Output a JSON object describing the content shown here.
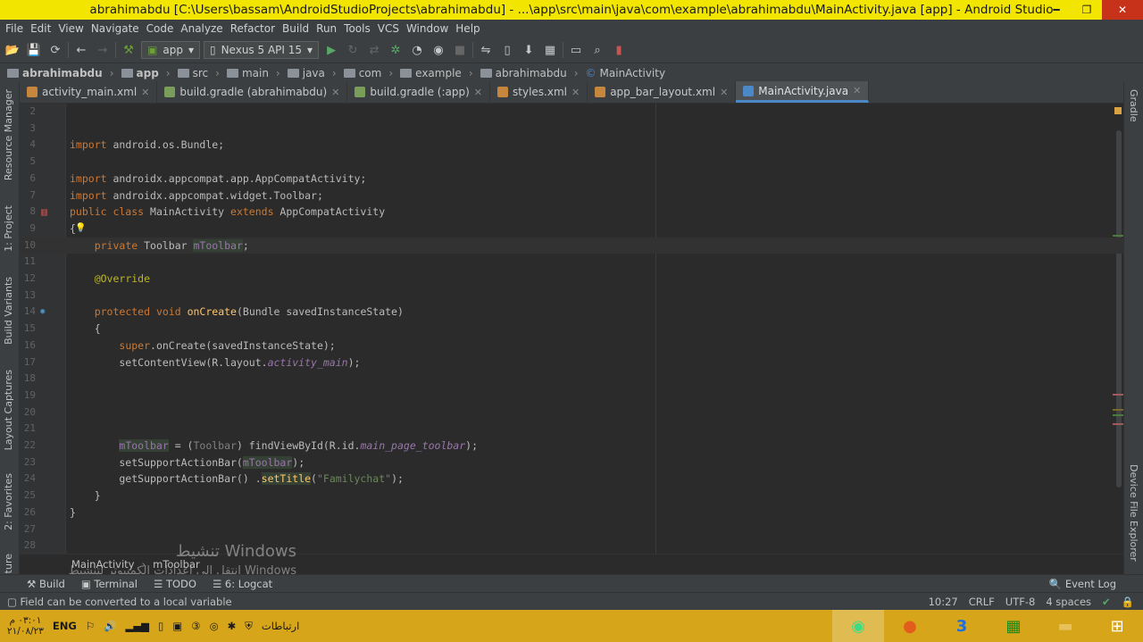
{
  "window": {
    "title": "abrahimabdu [C:\\Users\\bassam\\AndroidStudioProjects\\abrahimabdu] - ...\\app\\src\\main\\java\\com\\example\\abrahimabdu\\MainActivity.java [app] - Android Studio"
  },
  "menu": [
    "File",
    "Edit",
    "View",
    "Navigate",
    "Code",
    "Analyze",
    "Refactor",
    "Build",
    "Run",
    "Tools",
    "VCS",
    "Window",
    "Help"
  ],
  "toolbar": {
    "run_config": "app",
    "device": "Nexus 5 API 15"
  },
  "breadcrumb": [
    "abrahimabdu",
    "app",
    "src",
    "main",
    "java",
    "com",
    "example",
    "abrahimabdu",
    "MainActivity"
  ],
  "tabs": [
    {
      "label": "activity_main.xml",
      "active": false
    },
    {
      "label": "build.gradle (abrahimabdu)",
      "active": false
    },
    {
      "label": "build.gradle (:app)",
      "active": false
    },
    {
      "label": "styles.xml",
      "active": false
    },
    {
      "label": "app_bar_layout.xml",
      "active": false
    },
    {
      "label": "MainActivity.java",
      "active": true
    }
  ],
  "left_tools": [
    "Resource Manager",
    "1: Project",
    "Build Variants",
    "Layout Captures",
    "2: Favorites",
    "ture"
  ],
  "right_tools": [
    "Gradle",
    "Device File Explorer"
  ],
  "code_lines": [
    {
      "n": "2",
      "html": ""
    },
    {
      "n": "3",
      "html": ""
    },
    {
      "n": "4",
      "html": "<span class=\"kw\">import</span> android.os.Bundle;"
    },
    {
      "n": "5",
      "html": ""
    },
    {
      "n": "6",
      "html": "<span class=\"kw\">import</span> androidx.appcompat.app.AppCompatActivity;"
    },
    {
      "n": "7",
      "html": "<span class=\"kw\">import</span> androidx.appcompat.widget.Toolbar;"
    },
    {
      "n": "8",
      "html": "<span class=\"kw\">public class</span> MainActivity <span class=\"kw\">extends</span> AppCompatActivity"
    },
    {
      "n": "9",
      "html": "{"
    },
    {
      "n": "10",
      "html": "    <span class=\"kw\">private</span> Toolbar <span class=\"fld hl\">mToolbar</span>;"
    },
    {
      "n": "11",
      "html": ""
    },
    {
      "n": "12",
      "html": "    <span class=\"ann\">@Override</span>"
    },
    {
      "n": "13",
      "html": ""
    },
    {
      "n": "14",
      "html": "    <span class=\"kw\">protected void</span> <span class=\"mth\">onCreate</span>(Bundle savedInstanceState)"
    },
    {
      "n": "15",
      "html": "    {"
    },
    {
      "n": "16",
      "html": "        <span class=\"kw\">super</span>.onCreate(savedInstanceState);"
    },
    {
      "n": "17",
      "html": "        setContentView(R.layout.<span class=\"ital\">activity_main</span>);"
    },
    {
      "n": "18",
      "html": ""
    },
    {
      "n": "19",
      "html": ""
    },
    {
      "n": "20",
      "html": ""
    },
    {
      "n": "21",
      "html": ""
    },
    {
      "n": "22",
      "html": "        <span class=\"fld hl\">mToolbar</span> = (<span class=\"grey\">Toolbar</span>) findViewById(R.id.<span class=\"ital\">main_page_toolbar</span>);"
    },
    {
      "n": "23",
      "html": "        setSupportActionBar(<span class=\"fld hl\">mToolbar</span>);"
    },
    {
      "n": "24",
      "html": "        getSupportActionBar() .<span class=\"mth hl\">setTitle</span>(<span class=\"str\">\"Familychat\"</span>);"
    },
    {
      "n": "25",
      "html": "    }"
    },
    {
      "n": "26",
      "html": "}"
    },
    {
      "n": "27",
      "html": ""
    },
    {
      "n": "28",
      "html": ""
    }
  ],
  "editor_breadcrumb": [
    "MainActivity",
    "mToolbar"
  ],
  "tool_windows": [
    "Build",
    "Terminal",
    "TODO",
    "6: Logcat"
  ],
  "event_log": "Event Log",
  "status": {
    "message": "Field can be converted to a local variable",
    "position": "10:27",
    "line_sep": "CRLF",
    "encoding": "UTF-8",
    "indent": "4 spaces"
  },
  "watermark": {
    "title": "تنشيط Windows",
    "sub": "انتقل إلى إعدادات الكمبيوتر لتنشيط Windows"
  },
  "taskbar": {
    "lang": "ENG",
    "network": "ارتباطات",
    "time": "٠٣:٠١ م",
    "date": "٢١/٠٨/٢٣"
  },
  "colors": {
    "accent": "#4a88c7",
    "titlebar": "#f2e600",
    "taskbar": "#d6a519"
  }
}
